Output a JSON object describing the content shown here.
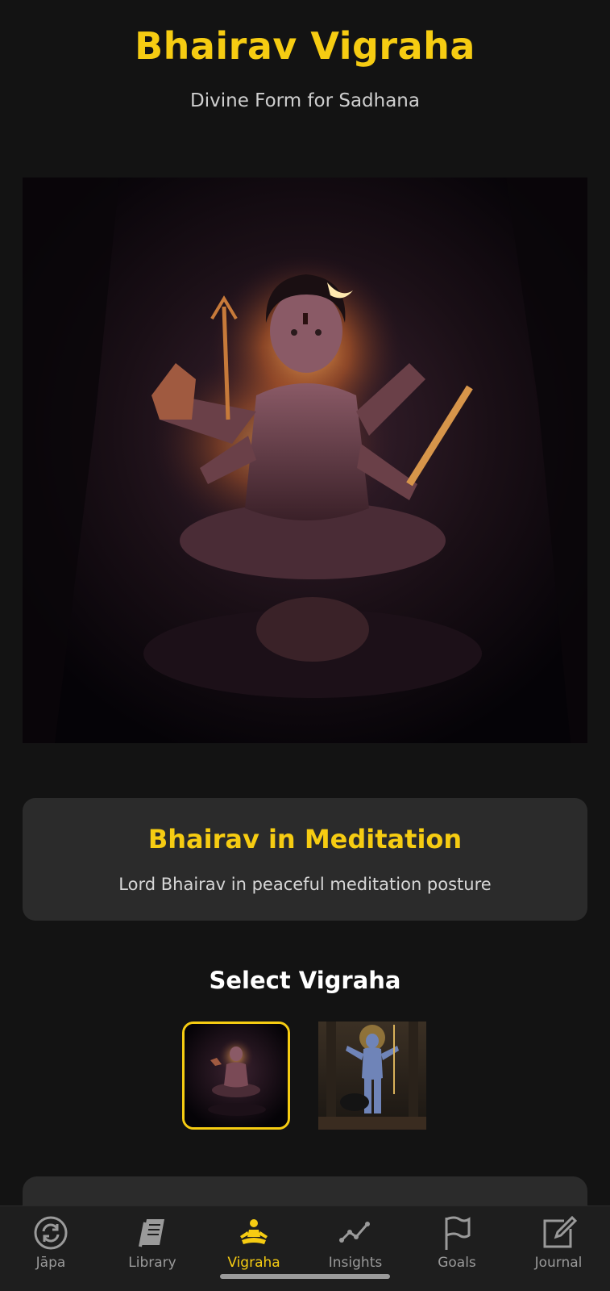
{
  "header": {
    "title": "Bhairav Vigraha",
    "subtitle": "Divine Form for Sadhana"
  },
  "selected_vigraha": {
    "name": "Bhairav in Meditation",
    "description": "Lord Bhairav in peaceful meditation posture"
  },
  "selector": {
    "title": "Select Vigraha",
    "selected_index": 0,
    "count": 2
  },
  "colors": {
    "accent": "#f6cc12",
    "background": "#131313",
    "card": "#2b2b2b",
    "nav_inactive": "#9a9a9a"
  },
  "bottom_nav": {
    "active": "Vigraha",
    "items": [
      {
        "label": "Jāpa",
        "icon": "refresh-circle-icon"
      },
      {
        "label": "Library",
        "icon": "book-icon"
      },
      {
        "label": "Vigraha",
        "icon": "meditation-icon"
      },
      {
        "label": "Insights",
        "icon": "line-chart-icon"
      },
      {
        "label": "Goals",
        "icon": "flag-icon"
      },
      {
        "label": "Journal",
        "icon": "edit-note-icon"
      }
    ]
  }
}
